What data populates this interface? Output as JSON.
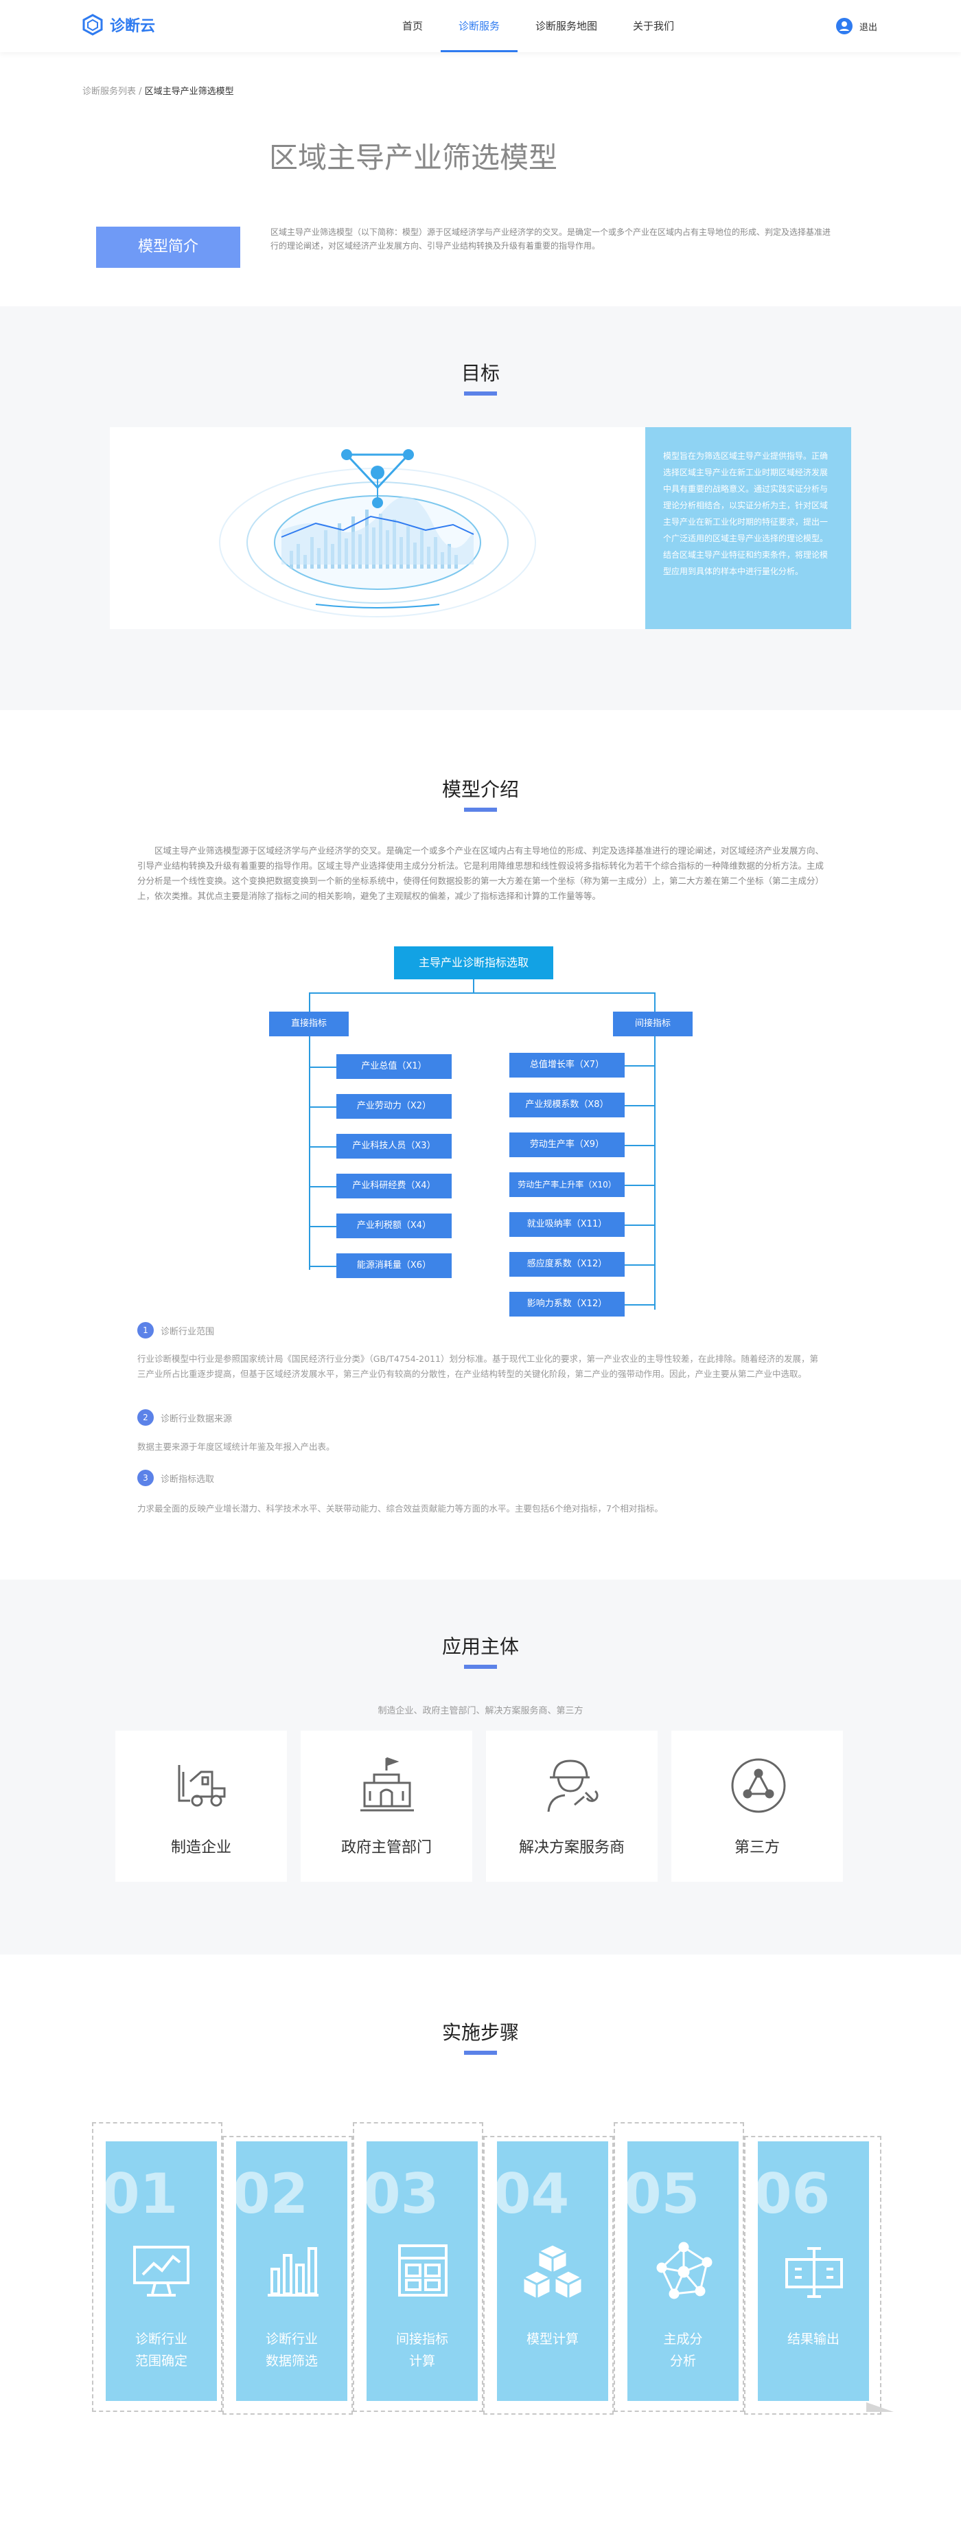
{
  "header": {
    "logo": "诊断云",
    "nav": [
      "首页",
      "诊断服务",
      "诊断服务地图",
      "关于我们"
    ],
    "logout": "退出"
  },
  "breadcrumb": {
    "parent": "诊断服务列表",
    "current": "区域主导产业筛选模型"
  },
  "page_title": "区域主导产业筛选模型",
  "intro": {
    "button": "模型简介",
    "text": "区域主导产业筛选模型（以下简称：模型）源于区域经济学与产业经济学的交叉。是确定一个或多个产业在区域内占有主导地位的形成、判定及选择基准进行的理论阐述，对区域经济产业发展方向、引导产业结构转换及升级有着重要的指导作用。"
  },
  "goal": {
    "title": "目标",
    "note": "模型旨在为筛选区域主导产业提供指导。正确选择区域主导产业在新工业时期区域经济发展中具有重要的战略意义。通过实践实证分析与理论分析相结合，以实证分析为主，针对区域主导产业在新工业化时期的特征要求，提出一个广泛适用的区域主导产业选择的理论模型。结合区域主导产业特征和约束条件，将理论模型应用到具体的样本中进行量化分析。"
  },
  "model": {
    "title": "模型介绍",
    "para": "区域主导产业筛选模型源于区域经济学与产业经济学的交叉。是确定一个或多个产业在区域内占有主导地位的形成、判定及选择基准进行的理论阐述，对区域经济产业发展方向、引导产业结构转换及升级有着重要的指导作用。区域主导产业选择使用主成分分析法。它是利用降维思想和线性假设将多指标转化为若干个综合指标的一种降维数据的分析方法。主成分分析是一个线性变换。这个变换把数据变换到一个新的坐标系统中，使得任何数据投影的第一大方差在第一个坐标（称为第一主成分）上，第二大方差在第二个坐标（第二主成分）上，依次类推。其优点主要是消除了指标之间的相关影响，避免了主观赋权的偏差，减少了指标选择和计算的工作量等等。",
    "tree": {
      "root": "主导产业诊断指标选取",
      "left_head": "直接指标",
      "right_head": "间接指标",
      "left": [
        "产业总值（X1）",
        "产业劳动力（X2）",
        "产业科技人员（X3）",
        "产业科研经费（X4）",
        "产业利税额（X4）",
        "能源消耗量（X6）"
      ],
      "right": [
        "总值增长率（X7）",
        "产业规模系数（X8）",
        "劳动生产率（X9）",
        "劳动生产率上升率（X10）",
        "就业吸纳率（X11）",
        "感应度系数（X12）",
        "影响力系数（X12）"
      ]
    },
    "items": [
      {
        "num": "1",
        "title": "诊断行业范围",
        "text": "行业诊断模型中行业是参照国家统计局《国民经济行业分类》（GB/T4754-2011）划分标准。基于现代工业化的要求，第一产业农业的主导性较差，在此排除。随着经济的发展，第三产业所占比重逐步提高，但基于区域经济发展水平，第三产业仍有较高的分散性，在产业结构转型的关键化阶段，第二产业的强带动作用。因此，产业主要从第二产业中选取。"
      },
      {
        "num": "2",
        "title": "诊断行业数据来源",
        "text": "数据主要来源于年度区域统计年鉴及年报入产出表。"
      },
      {
        "num": "3",
        "title": "诊断指标选取",
        "text": "力求最全面的反映产业增长潜力、科学技术水平、关联带动能力、综合效益贡献能力等方面的水平。主要包括6个绝对指标，7个相对指标。"
      }
    ]
  },
  "app": {
    "title": "应用主体",
    "sub": "制造企业、政府主管部门、解决方案服务商、第三方",
    "cards": [
      {
        "label": "制造企业",
        "icon": "forklift-icon"
      },
      {
        "label": "政府主管部门",
        "icon": "government-icon"
      },
      {
        "label": "解决方案服务商",
        "icon": "service-provider-icon"
      },
      {
        "label": "第三方",
        "icon": "third-party-icon"
      }
    ]
  },
  "steps": {
    "title": "实施步骤",
    "items": [
      {
        "num": "01",
        "label": "诊断行业\n范围确定",
        "icon": "monitor-chart-icon"
      },
      {
        "num": "02",
        "label": "诊断行业\n数据筛选",
        "icon": "bar-chart-icon"
      },
      {
        "num": "03",
        "label": "间接指标\n计算",
        "icon": "calculator-icon"
      },
      {
        "num": "04",
        "label": "模型计算",
        "icon": "cubes-icon"
      },
      {
        "num": "05",
        "label": "主成分\n分析",
        "icon": "network-icon"
      },
      {
        "num": "06",
        "label": "结果输出",
        "icon": "output-icon"
      }
    ]
  },
  "colors": {
    "primary": "#2f7bf0",
    "accent": "#5b82e8",
    "sky": "#8ed4f2",
    "tree": "#12a2e4"
  }
}
